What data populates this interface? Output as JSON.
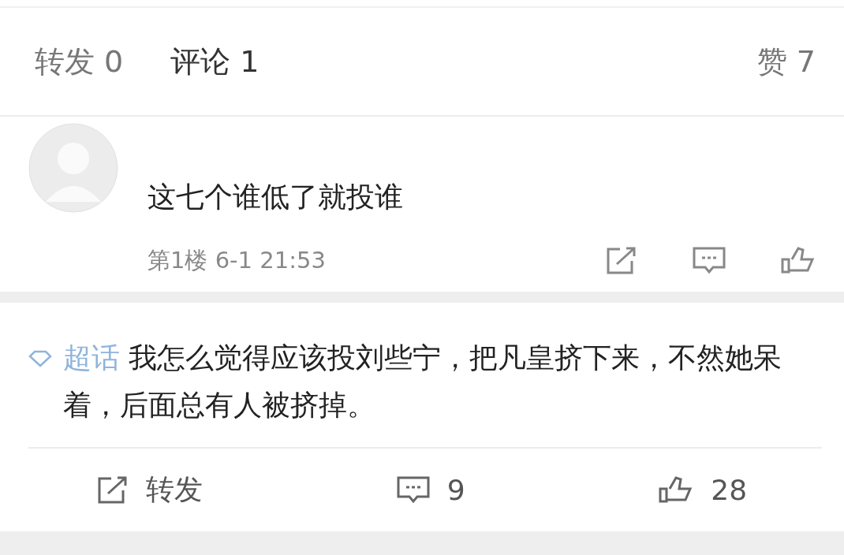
{
  "tabs": [
    {
      "label": "转发 0",
      "selected": false
    },
    {
      "label": "评论 1",
      "selected": true
    },
    {
      "label": "赞 7",
      "selected": false
    }
  ],
  "comment": {
    "text": "这七个谁低了就投谁",
    "floor": "第1楼 6-1 21:53"
  },
  "post": {
    "topic": "超话",
    "text": "我怎么觉得应该投刘些宁，把凡皇挤下来，不然她呆着，后面总有人被挤掉。"
  },
  "actions": [
    {
      "kind": "repost",
      "label": "转发"
    },
    {
      "kind": "comment",
      "label": "9"
    },
    {
      "kind": "like",
      "label": "28"
    }
  ]
}
